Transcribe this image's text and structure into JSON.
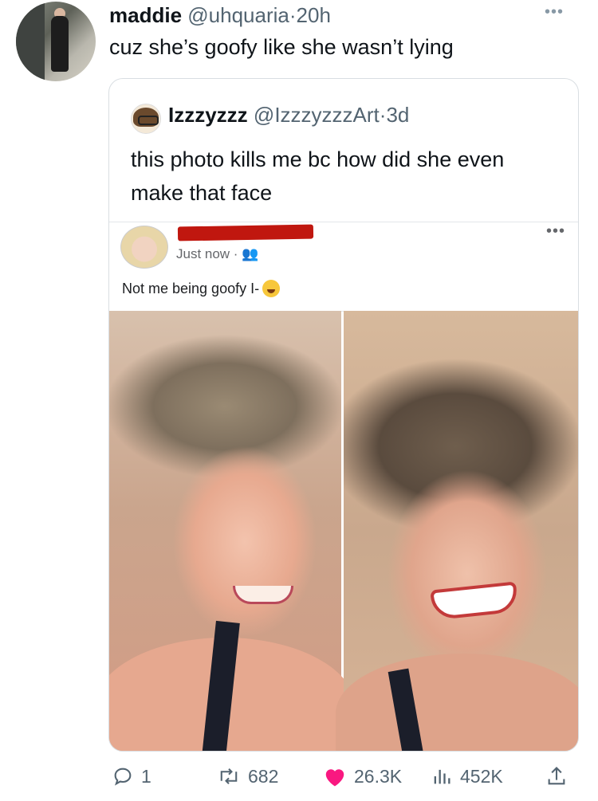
{
  "tweet": {
    "author_name": "maddie",
    "handle": "@uhquaria",
    "separator": "·",
    "time": "20h",
    "text": "cuz she’s goofy like she wasn’t lying"
  },
  "quoted": {
    "author_name": "Izzzyzzz",
    "handle": "@IzzzyzzzArt",
    "separator": "·",
    "time": "3d",
    "text": "this photo kills me bc how did she even make that face"
  },
  "fb_post": {
    "time": "Just now ·",
    "text": "Not me being goofy I-"
  },
  "stats": {
    "replies": "1",
    "retweets": "682",
    "likes": "26.3K",
    "views": "452K"
  },
  "icons": {
    "reply": "reply-icon",
    "retweet": "retweet-icon",
    "like": "heart-icon",
    "views": "views-icon",
    "share": "share-icon"
  },
  "colors": {
    "like": "#f91880",
    "muted": "#536471"
  }
}
